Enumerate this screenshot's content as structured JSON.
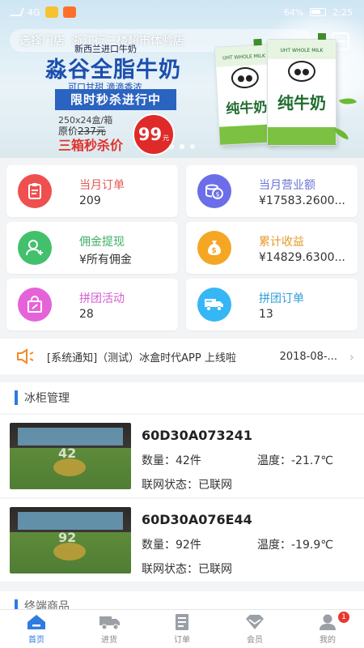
{
  "status_bar": {
    "network": "4G",
    "battery": "64%",
    "time": "2:25"
  },
  "banner": {
    "store_label": "选择门店",
    "store_name": "浙江行二楼超市体验店",
    "promo": {
      "subtitle": "新西兰进口牛奶",
      "title": "淼谷全脂牛奶",
      "tagline": "可口甘甜   滴滴香浓",
      "ribbon": "限时秒杀进行中",
      "spec": "250x24盒/箱",
      "original_label": "原价",
      "original_price": "237元",
      "deal": "三箱秒杀价",
      "price": "99",
      "price_unit": "元"
    },
    "carton_text_a": "纯牛奶",
    "carton_text_b": "纯牛奶",
    "carton_tiny": "UHT WHOLE MILK",
    "page_count": 3,
    "active_page": 1
  },
  "stats": [
    {
      "title": "当月订单",
      "value": "209",
      "icon": "clipboard-icon",
      "color": "#ef4f4f",
      "title_color": "#e05a56"
    },
    {
      "title": "当月营业额",
      "value": "¥17583.2600...",
      "icon": "coins-icon",
      "color": "#6b6ee8",
      "title_color": "#6a73d6"
    },
    {
      "title": "佣金提现",
      "value": "¥所有佣金",
      "icon": "user-add-icon",
      "color": "#43c06c",
      "title_color": "#3fae66"
    },
    {
      "title": "累计收益",
      "value": "¥14829.6300...",
      "icon": "money-bag-icon",
      "color": "#f5a623",
      "title_color": "#e49a2a"
    },
    {
      "title": "拼团活动",
      "value": "28",
      "icon": "bag-icon",
      "color": "#e563d8",
      "title_color": "#d55fce"
    },
    {
      "title": "拼团订单",
      "value": "13",
      "icon": "truck-icon",
      "color": "#35b7f5",
      "title_color": "#2f9ed8"
    }
  ],
  "notice": {
    "text": "[系统通知]（测试）冰盒时代APP 上线啦",
    "date": "2018-08-..."
  },
  "fridge_section": {
    "title": "冰柜管理",
    "items": [
      {
        "id": "60D30A073241",
        "qty_label": "数量：",
        "qty": "42件",
        "temp_label": "温度：",
        "temp": "-21.7℃",
        "net_label": "联网状态：",
        "net": "已联网",
        "img_number": "42"
      },
      {
        "id": "60D30A076E44",
        "qty_label": "数量：",
        "qty": "92件",
        "temp_label": "温度：",
        "temp": "-19.9℃",
        "net_label": "联网状态：",
        "net": "已联网",
        "img_number": "92"
      }
    ]
  },
  "next_section_peek": "终端商品",
  "tabs": [
    {
      "label": "首页",
      "icon": "home-icon",
      "active": true
    },
    {
      "label": "进货",
      "icon": "truck-icon",
      "active": false
    },
    {
      "label": "订单",
      "icon": "order-list-icon",
      "active": false
    },
    {
      "label": "会员",
      "icon": "diamond-icon",
      "active": false
    },
    {
      "label": "我的",
      "icon": "person-icon",
      "active": false,
      "badge": "1"
    }
  ],
  "colors": {
    "accent": "#2f7be0",
    "price_red": "#e02a2a"
  }
}
